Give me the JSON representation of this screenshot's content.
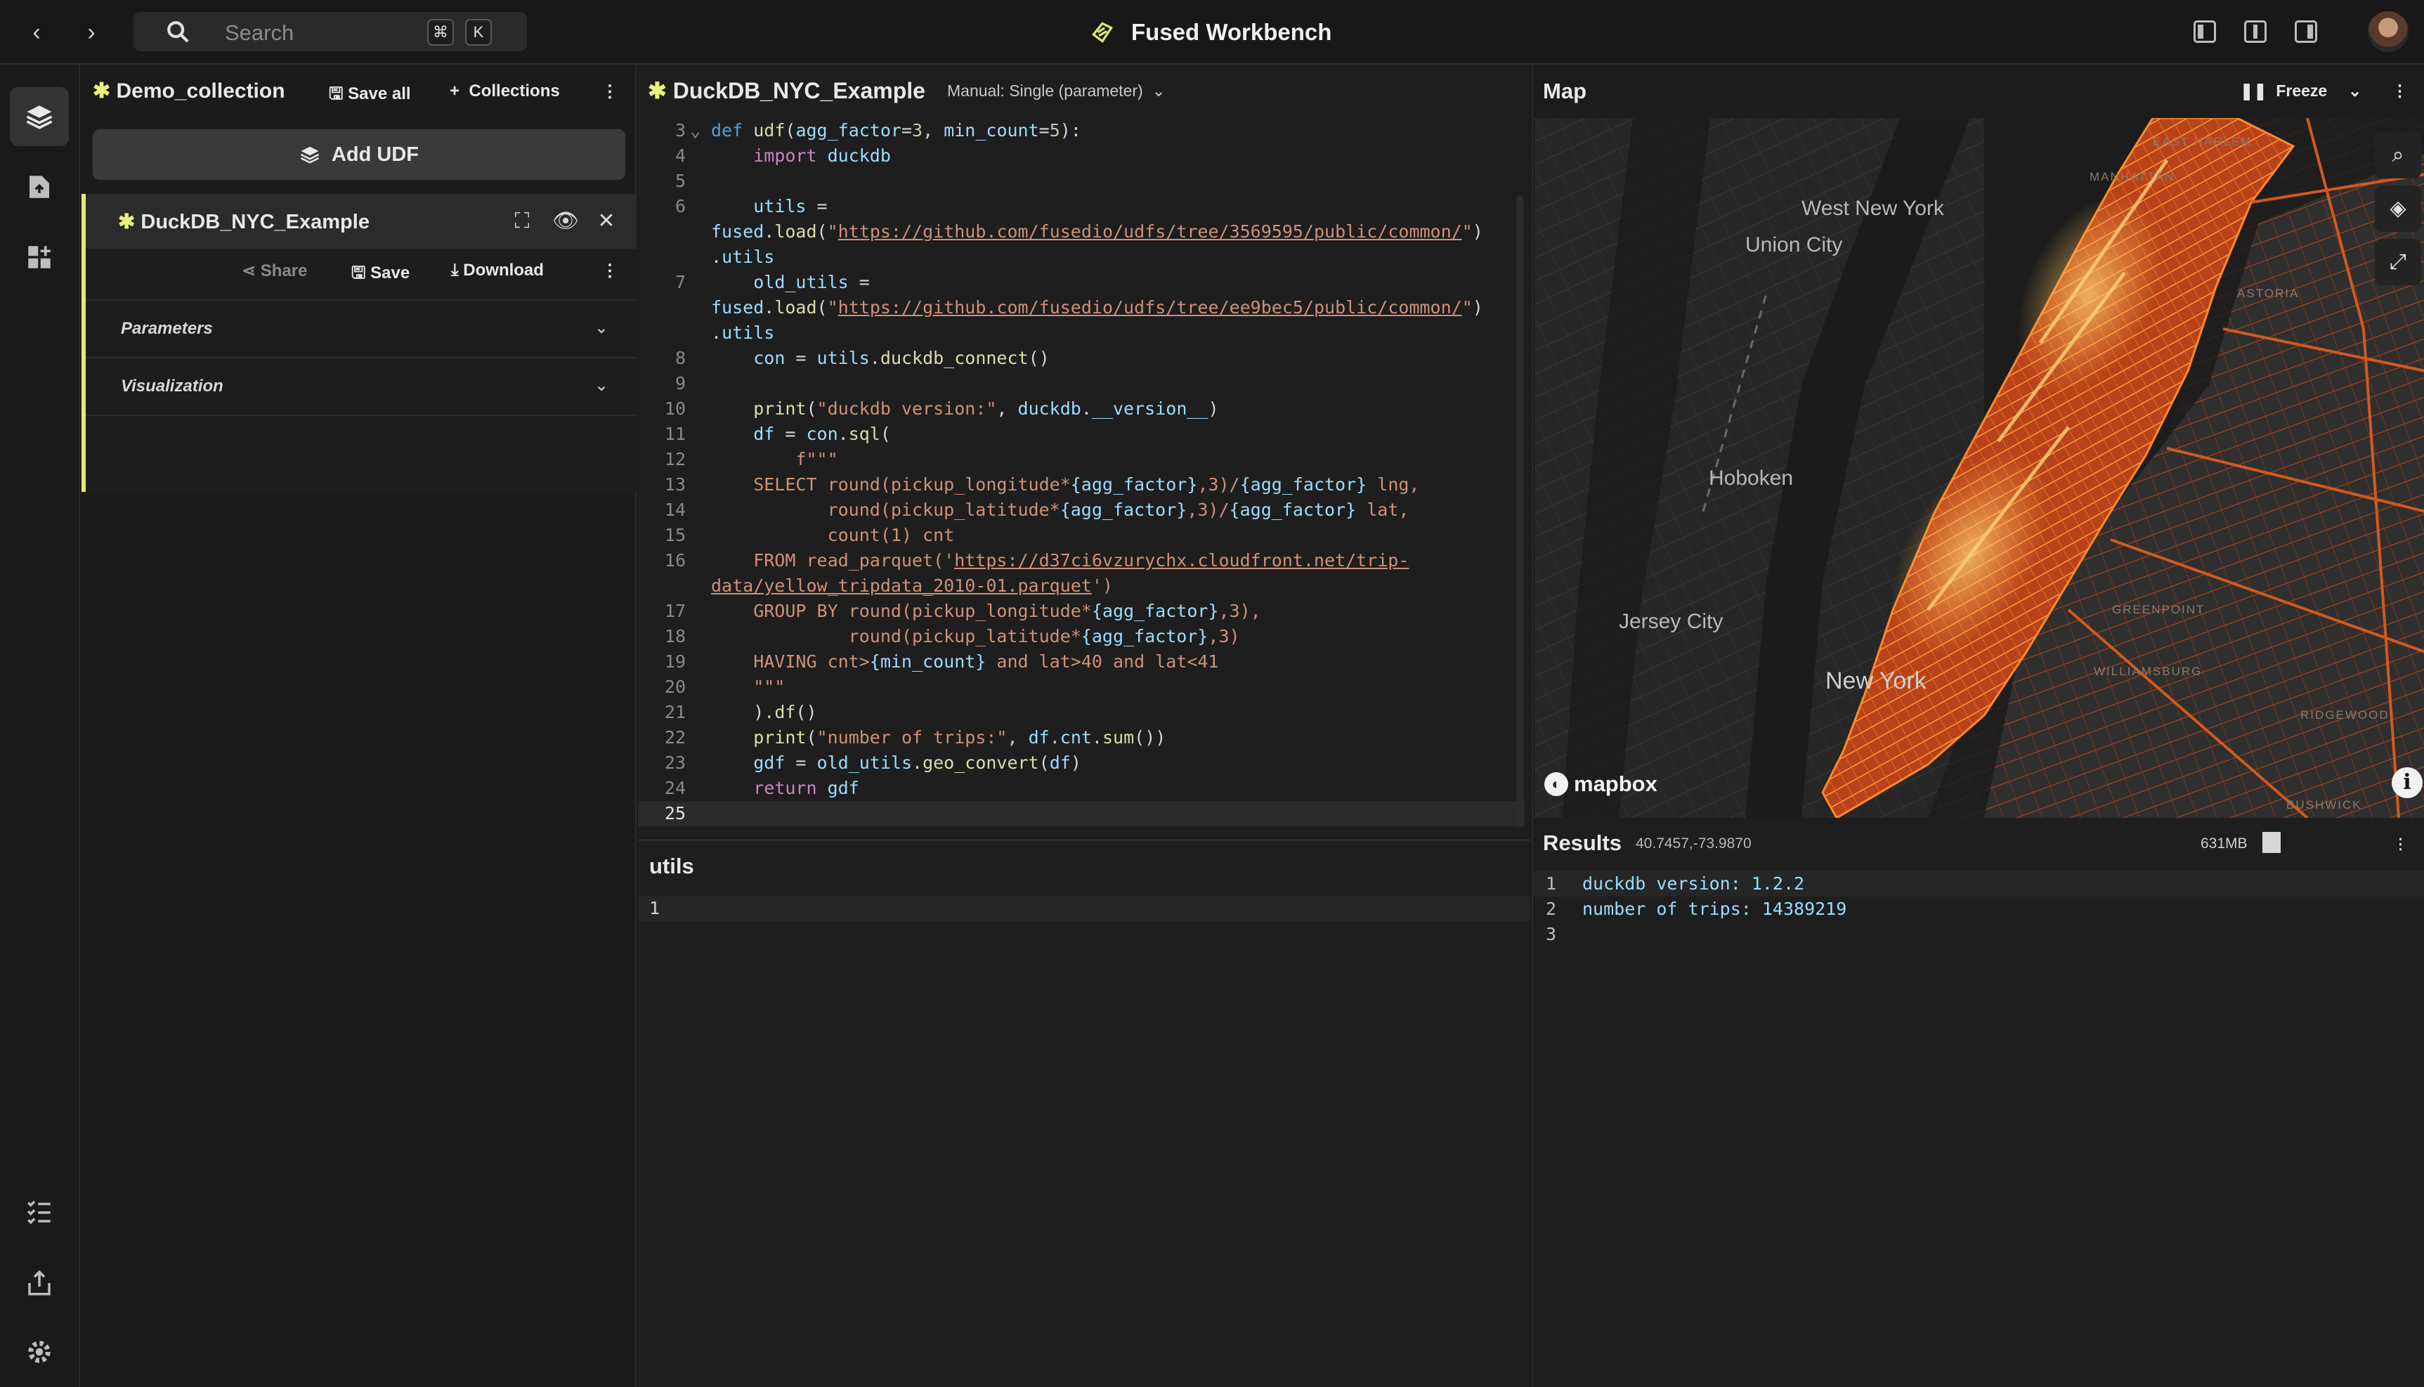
{
  "topbar": {
    "search_placeholder": "Search",
    "kbd_cmd": "⌘",
    "kbd_k": "K",
    "app_title": "Fused Workbench"
  },
  "collection": {
    "name": "Demo_collection",
    "save_all": "Save all",
    "collections": "Collections",
    "add_udf": "Add UDF"
  },
  "udf": {
    "name": "DuckDB_NYC_Example",
    "share": "Share",
    "save": "Save",
    "download": "Download",
    "parameters": "Parameters",
    "visualization": "Visualization",
    "accent_color": "#e3ea72"
  },
  "editor": {
    "title": "DuckDB_NYC_Example",
    "mode": "Manual: Single (parameter)",
    "lines": [
      {
        "n": "3",
        "fold": true
      },
      {
        "n": "4"
      },
      {
        "n": "5"
      },
      {
        "n": "6"
      },
      {
        "n": ""
      },
      {
        "n": ""
      },
      {
        "n": "7"
      },
      {
        "n": ""
      },
      {
        "n": ""
      },
      {
        "n": "8"
      },
      {
        "n": "9"
      },
      {
        "n": "10"
      },
      {
        "n": "11"
      },
      {
        "n": "12"
      },
      {
        "n": "13"
      },
      {
        "n": "14"
      },
      {
        "n": "15"
      },
      {
        "n": "16"
      },
      {
        "n": ""
      },
      {
        "n": "17"
      },
      {
        "n": "18"
      },
      {
        "n": "19"
      },
      {
        "n": "20"
      },
      {
        "n": "21"
      },
      {
        "n": "22"
      },
      {
        "n": "23"
      },
      {
        "n": "24"
      },
      {
        "n": "25",
        "current": true
      }
    ]
  },
  "utils_panel": {
    "title": "utils",
    "line1": "1"
  },
  "map": {
    "title": "Map",
    "freeze": "Freeze",
    "places": [
      "West New York",
      "Union City",
      "Hoboken",
      "Jersey City",
      "New York"
    ],
    "neighborhoods": [
      "EAST HARLEM",
      "MANHATTAN",
      "ASTORIA",
      "GREENPOINT",
      "WILLIAMSBURG",
      "RIDGEWOOD",
      "BUSHWICK"
    ],
    "attribution": "mapbox"
  },
  "results": {
    "title": "Results",
    "coords": "40.7457,-73.9870",
    "memory": "631MB",
    "lines": [
      {
        "n": "1",
        "text": "duckdb version: 1.2.2"
      },
      {
        "n": "2",
        "text": "number of trips: 14389219"
      },
      {
        "n": "3",
        "text": ""
      }
    ]
  }
}
